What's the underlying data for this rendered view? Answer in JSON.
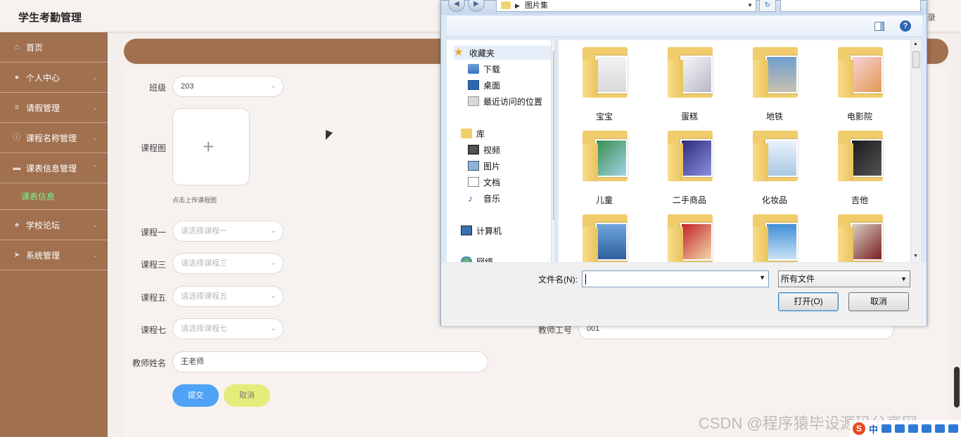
{
  "app": {
    "title": "学生考勤管理",
    "top_right_text": "录"
  },
  "sidebar": {
    "items": [
      {
        "label": "首页",
        "icon": "home-icon"
      },
      {
        "label": "个人中心",
        "icon": "user-icon"
      },
      {
        "label": "请假管理",
        "icon": "list-icon"
      },
      {
        "label": "课程名称管理",
        "icon": "info-icon"
      },
      {
        "label": "课表信息管理",
        "icon": "monitor-icon"
      },
      {
        "label": "学校论坛",
        "icon": "thumb-icon"
      },
      {
        "label": "系统管理",
        "icon": "send-icon"
      }
    ],
    "active_subitem": "课表信息"
  },
  "form": {
    "class_label": "班级",
    "class_value": "203",
    "course_image_label": "课程图",
    "upload_hint": "点击上传课程图",
    "course1_label": "课程一",
    "course1_placeholder": "请选择课程一",
    "course3_label": "课程三",
    "course3_placeholder": "请选择课程三",
    "course5_label": "课程五",
    "course5_placeholder": "请选择课程五",
    "course7_label": "课程七",
    "course7_placeholder": "请选择课程七",
    "teacher_no_label": "教师工号",
    "teacher_no_value": "001",
    "teacher_name_label": "教师姓名",
    "teacher_name_value": "王老师",
    "submit_label": "提交",
    "cancel_label": "取消"
  },
  "dialog": {
    "address": "图片集",
    "nav": {
      "favorites": "收藏夹",
      "downloads": "下载",
      "desktop": "桌面",
      "recent": "最近访问的位置",
      "libraries": "库",
      "videos": "视频",
      "pictures": "图片",
      "documents": "文档",
      "music": "音乐",
      "computer": "计算机",
      "network": "网络"
    },
    "folders": [
      "宝宝",
      "蛋糕",
      "地铁",
      "电影院",
      "儿童",
      "二手商品",
      "化妆品",
      "吉他"
    ],
    "filename_label": "文件名(N):",
    "filename_value": "",
    "filetype_value": "所有文件",
    "open_label": "打开(O)",
    "cancel_label": "取消"
  },
  "watermark": "CSDN @程序猿毕设源码分享网",
  "ime": {
    "logo": "S",
    "mode": "中"
  },
  "colors": {
    "sidebar": "#a0704f",
    "submit": "#4fa3f7",
    "cancel": "#e6ec7a",
    "active_sub": "#7cf08a"
  }
}
